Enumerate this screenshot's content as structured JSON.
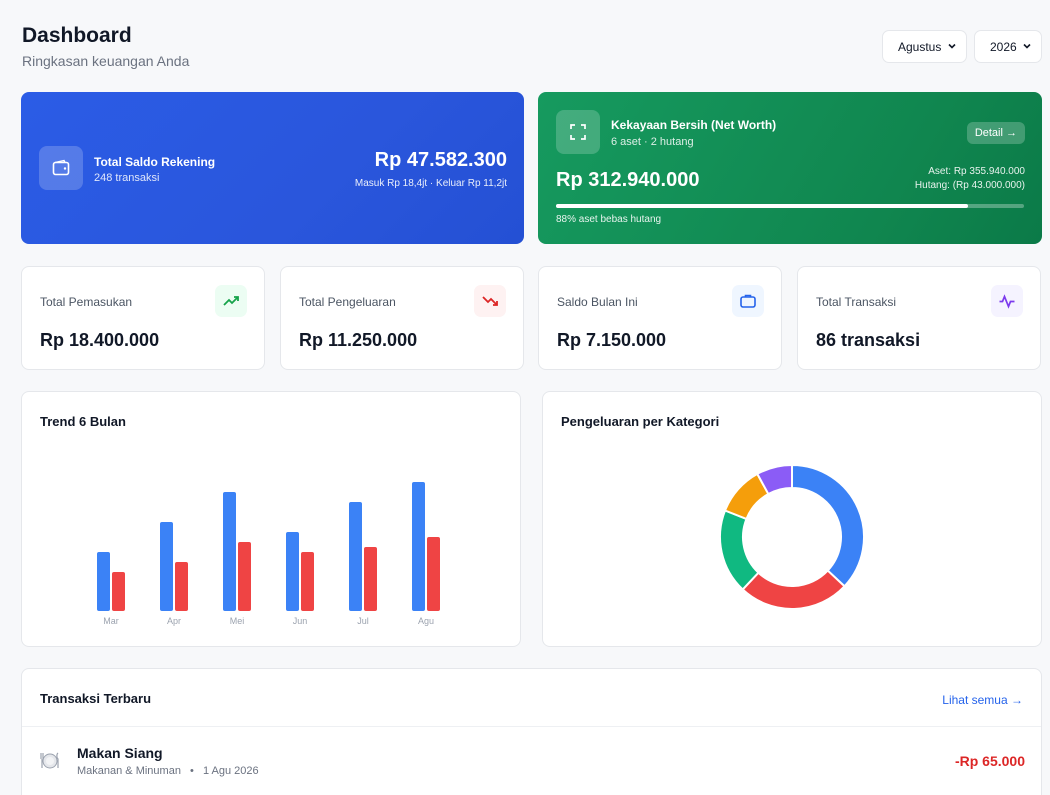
{
  "header": {
    "title": "Dashboard",
    "subtitle": "Ringkasan keuangan Anda"
  },
  "filters": {
    "month": "Agustus",
    "year": "2026"
  },
  "balance_card": {
    "title": "Total Saldo Rekening",
    "subtitle": "248 transaksi",
    "amount": "Rp 47.582.300",
    "flow": "Masuk Rp 18,4jt · Keluar Rp 11,2jt",
    "icon": "wallet-icon"
  },
  "networth_card": {
    "title": "Kekayaan Bersih (Net Worth)",
    "subtitle": "6 aset · 2 hutang",
    "detail_label": "Detail →",
    "amount": "Rp 312.940.000",
    "assets": "Aset: Rp 355.940.000",
    "debts": "Hutang: (Rp 43.000.000)",
    "progress_note": "88% aset bebas hutang",
    "progress": 0.88,
    "icon": "expand-icon"
  },
  "stats": [
    {
      "label": "Total Pemasukan",
      "value": "Rp 18.400.000",
      "icon": "trend-up-icon",
      "color": "#16a34a"
    },
    {
      "label": "Total Pengeluaran",
      "value": "Rp 11.250.000",
      "icon": "trend-down-icon",
      "color": "#dc2626"
    },
    {
      "label": "Saldo Bulan Ini",
      "value": "Rp 7.150.000",
      "icon": "briefcase-icon",
      "color": "#2563eb"
    },
    {
      "label": "Total Transaksi",
      "value": "86 transaksi",
      "icon": "activity-icon",
      "color": "#7c3aed"
    }
  ],
  "trend_panel": {
    "title": "Trend 6 Bulan"
  },
  "category_panel": {
    "title": "Pengeluaran per Kategori"
  },
  "transactions": {
    "title": "Transaksi Terbaru",
    "link": "Lihat semua →",
    "items": [
      {
        "name": "Makan Siang",
        "category": "Makanan & Minuman",
        "date": "1 Agu 2026",
        "amount": "-Rp 65.000",
        "icon": "plate-icon"
      }
    ]
  },
  "chart_data": [
    {
      "type": "bar",
      "categories": [
        "Mar",
        "Apr",
        "Mei",
        "Jun",
        "Jul",
        "Agu"
      ],
      "series": [
        {
          "values": [
            11.8,
            17.8,
            23.8,
            15.8,
            21.8,
            25.8
          ],
          "color": "#3b82f6"
        },
        {
          "values": [
            7.8,
            9.8,
            13.8,
            11.8,
            12.8,
            14.8
          ],
          "color": "#ef4444"
        }
      ],
      "ylim": [
        0,
        30
      ],
      "grid": false
    },
    {
      "type": "pie",
      "donut": true,
      "values": [
        37,
        25,
        19,
        11,
        8
      ],
      "colors": [
        "#3b82f6",
        "#ef4444",
        "#10b981",
        "#f59e0b",
        "#8b5cf6"
      ]
    }
  ]
}
